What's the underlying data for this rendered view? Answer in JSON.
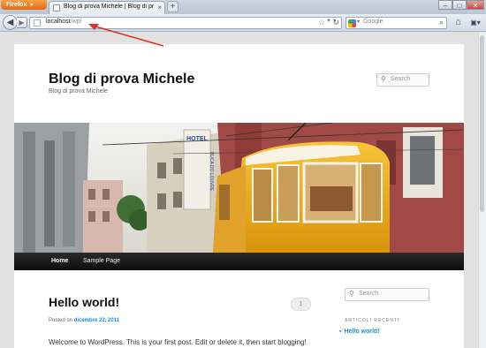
{
  "browser": {
    "firefox_button": "Firefox",
    "tab_title": "Blog di prova Michele | Blog di prova Mi...",
    "url_host": "localhost",
    "url_path": "/wp/",
    "search_engine_placeholder": "Google"
  },
  "site": {
    "title": "Blog di prova Michele",
    "description": "Blog di prova Michele",
    "search_placeholder": "Search",
    "banner_sign_hotel": "HOTEL",
    "banner_sign_side": "DUCA DO LOUVRE"
  },
  "menu": {
    "home": "Home",
    "sample_page": "Sample Page"
  },
  "post": {
    "title": "Hello world!",
    "posted_on": "Posted on",
    "date": "dicembre 22, 2011",
    "comment_count": "1",
    "body": "Welcome to WordPress. This is your first post. Edit or delete it, then start blogging!"
  },
  "sidebar": {
    "search_placeholder": "Search",
    "recent_heading": "ARTICOLI RECENTI",
    "recent_items": [
      "Hello world!"
    ]
  },
  "colors": {
    "link": "#1b8be0",
    "menubar": "#1a1a1a",
    "annotation_arrow": "#d9322a",
    "tram": "#f2b21b"
  }
}
